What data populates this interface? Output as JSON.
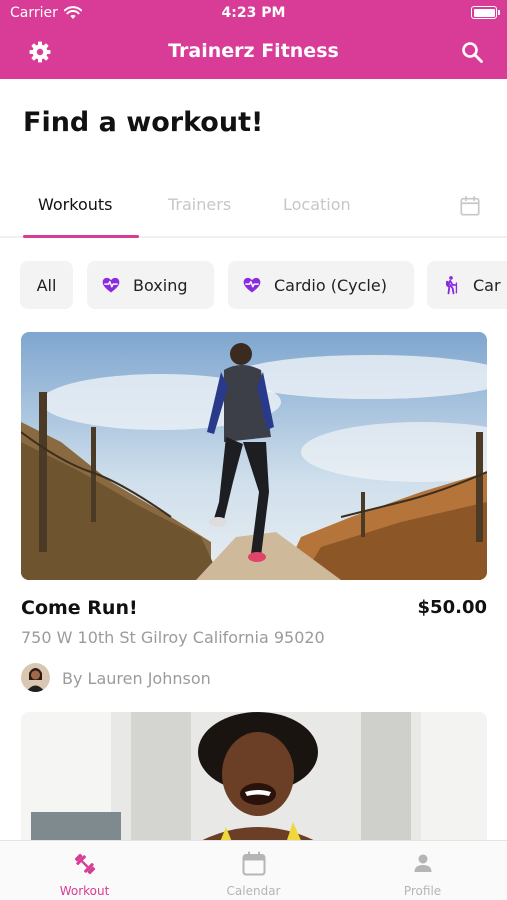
{
  "status_bar": {
    "carrier": "Carrier",
    "time": "4:23 PM"
  },
  "nav": {
    "title": "Trainerz Fitness",
    "left_icon": "gear-icon",
    "right_icon": "search-icon"
  },
  "page": {
    "heading": "Find a workout!"
  },
  "tabs": [
    {
      "label": "Workouts",
      "active": true
    },
    {
      "label": "Trainers",
      "active": false
    },
    {
      "label": "Location",
      "active": false
    }
  ],
  "calendar_tab_icon": "calendar-icon",
  "categories": [
    {
      "label": "All",
      "icon": ""
    },
    {
      "label": "Boxing",
      "icon": "heartbeat-icon"
    },
    {
      "label": "Cardio (Cycle)",
      "icon": "heartbeat-icon"
    },
    {
      "label": "Car",
      "icon": "hiking-icon"
    }
  ],
  "workouts": [
    {
      "title": "Come Run!",
      "price": "$50.00",
      "address": "750 W 10th St Gilroy California 95020",
      "trainer": "By Lauren Johnson"
    }
  ],
  "bottom_tabs": [
    {
      "label": "Workout",
      "icon": "dumbbell-icon",
      "active": true
    },
    {
      "label": "Calendar",
      "icon": "calendar-icon",
      "active": false
    },
    {
      "label": "Profile",
      "icon": "person-icon",
      "active": false
    }
  ],
  "colors": {
    "brand": "#d93c96",
    "chip_icon": "#8a2be2",
    "inactive_text": "#c7c7c7",
    "secondary_text": "#9b9b9b",
    "chip_background": "#f3f3f3"
  }
}
